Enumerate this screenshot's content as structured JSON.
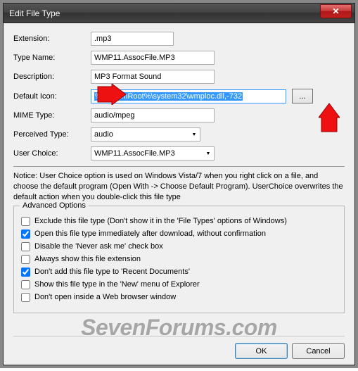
{
  "titlebar": {
    "title": "Edit File Type",
    "close_glyph": "✕"
  },
  "form": {
    "extension": {
      "label": "Extension:",
      "value": ".mp3"
    },
    "typeName": {
      "label": "Type Name:",
      "value": "WMP11.AssocFile.MP3"
    },
    "description": {
      "label": "Description:",
      "value": "MP3 Format Sound"
    },
    "defaultIcon": {
      "label": "Default Icon:",
      "value": "%SystemRoot%\\system32\\wmploc.dll,-732",
      "browse": "..."
    },
    "mimeType": {
      "label": "MIME Type:",
      "value": "audio/mpeg"
    },
    "perceivedType": {
      "label": "Perceived Type:",
      "value": "audio"
    },
    "userChoice": {
      "label": "User Choice:",
      "value": "WMP11.AssocFile.MP3"
    }
  },
  "notice": "Notice: User Choice option is used on Windows Vista/7 when you right click on a file, and choose the default program (Open With -> Choose Default Program). UserChoice overwrites the default action when you double-click this file type",
  "advanced": {
    "legend": "Advanced Options",
    "opts": [
      {
        "label": "Exclude  this file type (Don't show it in the 'File Types' options of Windows)",
        "checked": false
      },
      {
        "label": "Open this file type immediately after download, without confirmation",
        "checked": true
      },
      {
        "label": "Disable the 'Never ask me' check box",
        "checked": false
      },
      {
        "label": "Always show this file extension",
        "checked": false
      },
      {
        "label": "Don't add this file type to 'Recent Documents'",
        "checked": true
      },
      {
        "label": "Show this file type in the 'New' menu of Explorer",
        "checked": false
      },
      {
        "label": "Don't open inside a Web browser window",
        "checked": false
      }
    ]
  },
  "buttons": {
    "ok": "OK",
    "cancel": "Cancel"
  },
  "watermark": "SevenForums.com"
}
